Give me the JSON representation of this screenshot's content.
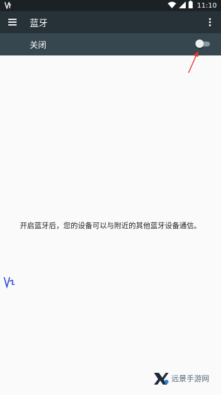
{
  "status_bar": {
    "time": "11:10",
    "icons": [
      "vf-logo-icon",
      "wifi-icon",
      "signal-icon",
      "battery-icon"
    ]
  },
  "app_bar": {
    "title": "蓝牙",
    "menu_icon": "hamburger-menu-icon",
    "more_icon": "more-vert-icon"
  },
  "bluetooth_toggle": {
    "label": "关闭",
    "state": "off"
  },
  "main": {
    "hint": "开启蓝牙后，您的设备可以与附近的其他蓝牙设备通信。"
  },
  "watermark": {
    "text": "远景手游网"
  },
  "colors": {
    "status_bar": "#1c2125",
    "app_bar": "#263238",
    "toggle_bar": "#37474f",
    "background": "#fafafa",
    "annotation": "#e53935"
  }
}
